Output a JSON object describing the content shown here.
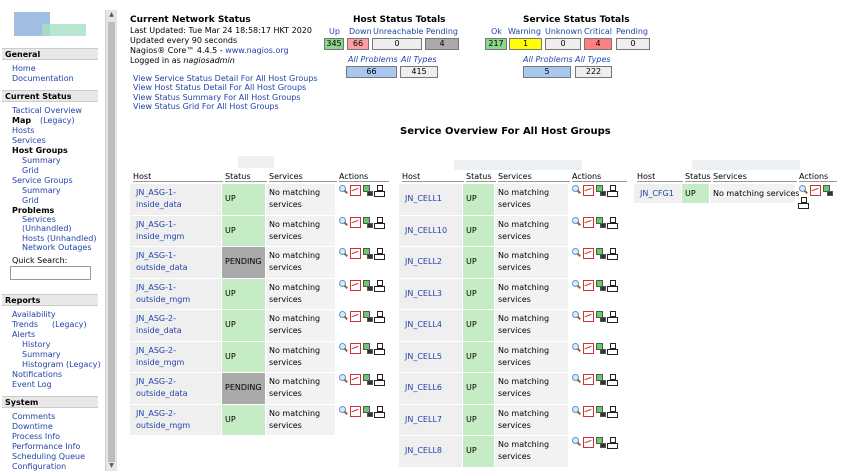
{
  "sidebar": {
    "general_header": "General",
    "home": "Home",
    "documentation": "Documentation",
    "current_status_header": "Current Status",
    "tactical_overview": "Tactical Overview",
    "map": "Map",
    "map_legacy": "(Legacy)",
    "hosts": "Hosts",
    "services": "Services",
    "host_groups": "Host Groups",
    "hg_summary": "Summary",
    "hg_grid": "Grid",
    "service_groups": "Service Groups",
    "sg_summary": "Summary",
    "sg_grid": "Grid",
    "problems": "Problems",
    "pr_services": "Services",
    "pr_unhandled": "(Unhandled)",
    "pr_hosts_unhandled": "Hosts (Unhandled)",
    "pr_network_outages": "Network Outages",
    "quick_search": "Quick Search:",
    "reports_header": "Reports",
    "availability": "Availability",
    "trends": "Trends",
    "trends_legacy": "(Legacy)",
    "alerts": "Alerts",
    "al_history": "History",
    "al_summary": "Summary",
    "al_histogram": "Histogram (Legacy)",
    "notifications": "Notifications",
    "event_log": "Event Log",
    "system_header": "System",
    "comments": "Comments",
    "downtime": "Downtime",
    "process_info": "Process Info",
    "performance_info": "Performance Info",
    "scheduling_queue": "Scheduling Queue",
    "configuration": "Configuration"
  },
  "status_info": {
    "title": "Current Network Status",
    "last_updated": "Last Updated: Tue Mar 24 18:58:17 HKT 2020",
    "update_interval": "Updated every 90 seconds",
    "version_prefix": "Nagios® Core™ 4.4.5 - ",
    "website": "www.nagios.org",
    "logged_in_prefix": "Logged in as ",
    "logged_in_user": "nagiosadmin",
    "links": [
      "View Service Status Detail For All Host Groups",
      "View Host Status Detail For All Host Groups",
      "View Status Summary For All Host Groups",
      "View Status Grid For All Host Groups"
    ]
  },
  "host_totals": {
    "title": "Host Status Totals",
    "labels": [
      "Up",
      "Down",
      "Unreachable",
      "Pending"
    ],
    "values": [
      "345",
      "66",
      "0",
      "4"
    ],
    "all_problems_label": "All Problems",
    "all_types_label": "All Types",
    "all_problems": "66",
    "all_types": "415"
  },
  "service_totals": {
    "title": "Service Status Totals",
    "labels": [
      "Ok",
      "Warning",
      "Unknown",
      "Critical",
      "Pending"
    ],
    "values": [
      "217",
      "1",
      "0",
      "4",
      "0"
    ],
    "all_problems_label": "All Problems",
    "all_types_label": "All Types",
    "all_problems": "5",
    "all_types": "222"
  },
  "overview_title": "Service Overview For All Host Groups",
  "columns": {
    "host": "Host",
    "status": "Status",
    "services": "Services",
    "actions": "Actions"
  },
  "groups": [
    {
      "rows": [
        {
          "host": "JN_ASG-1-\ninside_data",
          "status": "UP",
          "services": "No matching\nservices"
        },
        {
          "host": "JN_ASG-1-\ninside_mgm",
          "status": "UP",
          "services": "No matching\nservices"
        },
        {
          "host": "JN_ASG-1-\noutside_data",
          "status": "PENDING",
          "services": "No matching\nservices"
        },
        {
          "host": "JN_ASG-1-\noutside_mgm",
          "status": "UP",
          "services": "No matching\nservices"
        },
        {
          "host": "JN_ASG-2-\ninside_data",
          "status": "UP",
          "services": "No matching\nservices"
        },
        {
          "host": "JN_ASG-2-\ninside_mgm",
          "status": "UP",
          "services": "No matching\nservices"
        },
        {
          "host": "JN_ASG-2-\noutside_data",
          "status": "PENDING",
          "services": "No matching\nservices"
        },
        {
          "host": "JN_ASG-2-\noutside_mgm",
          "status": "UP",
          "services": "No matching\nservices"
        }
      ]
    },
    {
      "rows": [
        {
          "host": "JN_CELL1",
          "status": "UP",
          "services": "No matching\nservices"
        },
        {
          "host": "JN_CELL10",
          "status": "UP",
          "services": "No matching\nservices"
        },
        {
          "host": "JN_CELL2",
          "status": "UP",
          "services": "No matching\nservices"
        },
        {
          "host": "JN_CELL3",
          "status": "UP",
          "services": "No matching\nservices"
        },
        {
          "host": "JN_CELL4",
          "status": "UP",
          "services": "No matching\nservices"
        },
        {
          "host": "JN_CELL5",
          "status": "UP",
          "services": "No matching\nservices"
        },
        {
          "host": "JN_CELL6",
          "status": "UP",
          "services": "No matching\nservices"
        },
        {
          "host": "JN_CELL7",
          "status": "UP",
          "services": "No matching\nservices"
        },
        {
          "host": "JN_CELL8",
          "status": "UP",
          "services": "No matching\nservices"
        }
      ]
    },
    {
      "rows": [
        {
          "host": "JN_CFG1",
          "status": "UP",
          "services": "No matching services"
        }
      ]
    }
  ],
  "colors": {
    "up": "#c6ecc6",
    "pending": "#aaaaaa",
    "down": "#ff9e9e",
    "warning": "#ffff00",
    "critical": "#ff8080",
    "ok_total": "#8ad68a",
    "link": "#2244aa",
    "all_box": "#a8c8f0"
  }
}
